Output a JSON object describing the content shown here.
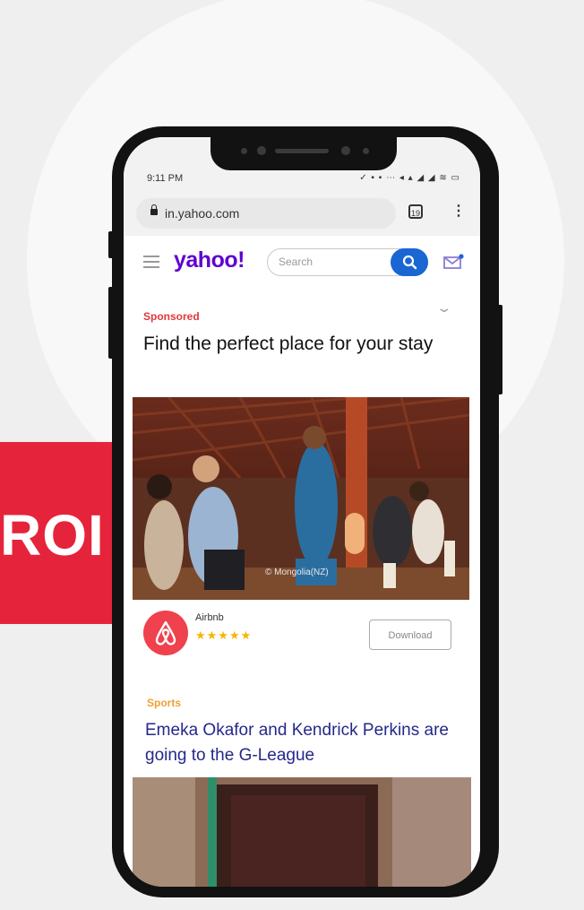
{
  "promo": {
    "badge_text": "ROI"
  },
  "status_bar": {
    "time": "9:11 PM",
    "icons": "✓ ▪ ▪ ⋯     ◂ ▴ ◢ ◢ ≋ ▭"
  },
  "browser": {
    "url": "in.yahoo.com",
    "tab_count": "19",
    "menu_icon": "kebab-menu-icon"
  },
  "header": {
    "logo": "yahoo!",
    "search_placeholder": "Search"
  },
  "ad": {
    "label": "Sponsored",
    "title": "Find the perfect place for your stay",
    "image_caption": "© Mongolia(NZ)",
    "advertiser": "Airbnb",
    "rating_stars": "★★★★★",
    "cta": "Download"
  },
  "article": {
    "category": "Sports",
    "headline": "Emeka Okafor and Kendrick Perkins are going to the G-League"
  },
  "colors": {
    "accent_red": "#e5243b",
    "yahoo_purple": "#5f01d1",
    "search_blue": "#1a66d3",
    "headline_blue": "#25288a"
  }
}
